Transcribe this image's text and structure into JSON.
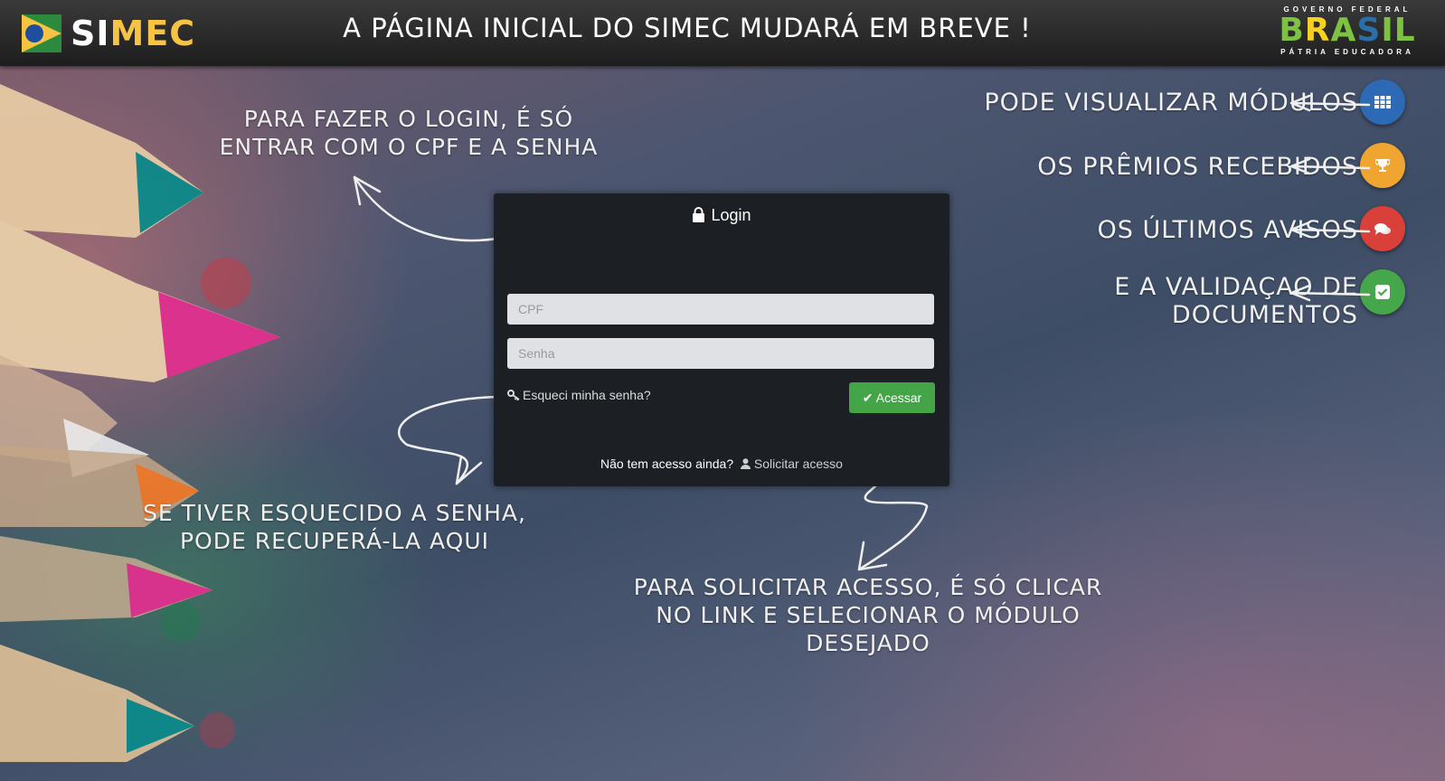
{
  "header": {
    "logo_text_white": "SI",
    "logo_text_yellow": "MEC",
    "headline": "A PÁGINA INICIAL DO SIMEC MUDARÁ EM BREVE !",
    "gov_top": "GOVERNO FEDERAL",
    "gov_brasil": [
      "B",
      "R",
      "A",
      "S",
      "I",
      "L"
    ],
    "gov_bottom": "PÁTRIA EDUCADORA"
  },
  "hints": {
    "login": "Para fazer o login, é só entrar com o CPF e a senha",
    "forgot": "Se tiver esquecido a senha, pode recuperá-la aqui",
    "request": "Para solicitar acesso, é só clicar no link e selecionar o módulo desejado"
  },
  "right_items": [
    {
      "label": "Pode visualizar módulos",
      "icon": "grid-icon",
      "color": "#2d6ab5"
    },
    {
      "label": "Os prêmios recebidos",
      "icon": "trophy-icon",
      "color": "#f0a530"
    },
    {
      "label": "Os últimos avisos",
      "icon": "chat-icon",
      "color": "#d9403a"
    },
    {
      "label": "E a validaçao de documentos",
      "icon": "check-square-icon",
      "color": "#45a64a"
    }
  ],
  "login": {
    "title": "Login",
    "cpf_placeholder": "CPF",
    "senha_placeholder": "Senha",
    "forgot_label": "Esqueci minha senha?",
    "submit_label": "Acessar",
    "no_access_label": "Não tem acesso ainda?",
    "request_label": "Solicitar acesso"
  }
}
